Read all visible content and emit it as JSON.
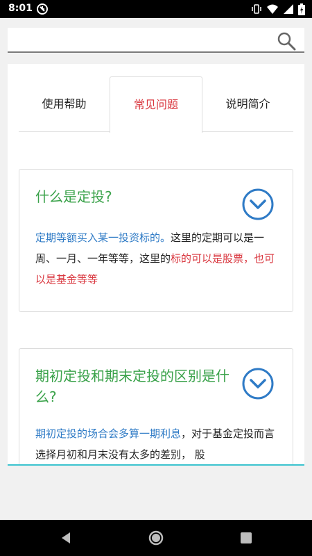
{
  "status_bar": {
    "time": "8:01"
  },
  "search": {
    "placeholder": "",
    "value": ""
  },
  "tabs": [
    {
      "label": "使用帮助",
      "active": false
    },
    {
      "label": "常见问题",
      "active": true
    },
    {
      "label": "说明简介",
      "active": false
    }
  ],
  "faq": [
    {
      "question": "什么是定投?",
      "answer_parts": [
        {
          "text": "定期等额买入某一投资标的。",
          "style": "blue"
        },
        {
          "text": "这里的定期可以是一周、一月、一年等等，这里的",
          "style": "normal"
        },
        {
          "text": "标的可以是股票，也可以是基金等等",
          "style": "red"
        }
      ]
    },
    {
      "question": "期初定投和期末定投的区别是什么?",
      "answer_parts": [
        {
          "text": "期初定投的场合会多算一期利息",
          "style": "blue"
        },
        {
          "text": "，对于基金定投而言选择月初和月末没有太多的差别， 股",
          "style": "normal"
        }
      ]
    }
  ],
  "colors": {
    "question_green": "#3aa24a",
    "highlight_blue": "#2f7bc6",
    "highlight_red": "#d9363e",
    "divider_teal": "#3cc3cf"
  }
}
